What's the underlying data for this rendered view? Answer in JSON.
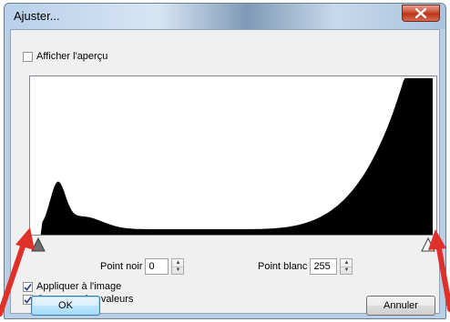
{
  "window": {
    "title": "Ajuster..."
  },
  "preview": {
    "label": "Afficher l'aperçu",
    "checked": false
  },
  "histogram": {
    "title": "",
    "note": "luminance histogram, strong peak near left, rising to right with spike at far right"
  },
  "point_noir": {
    "label": "Point noir",
    "value": "0"
  },
  "point_blanc": {
    "label": "Point blanc",
    "value": "255"
  },
  "apply": {
    "label": "Appliquer à l'image",
    "checked": true
  },
  "keep": {
    "label": "Conserver les valeurs",
    "checked": true
  },
  "buttons": {
    "ok": "OK",
    "cancel": "Annuler"
  },
  "colors": {
    "annotation_arrow": "#e0302a",
    "accent": "#3c7fb1"
  }
}
